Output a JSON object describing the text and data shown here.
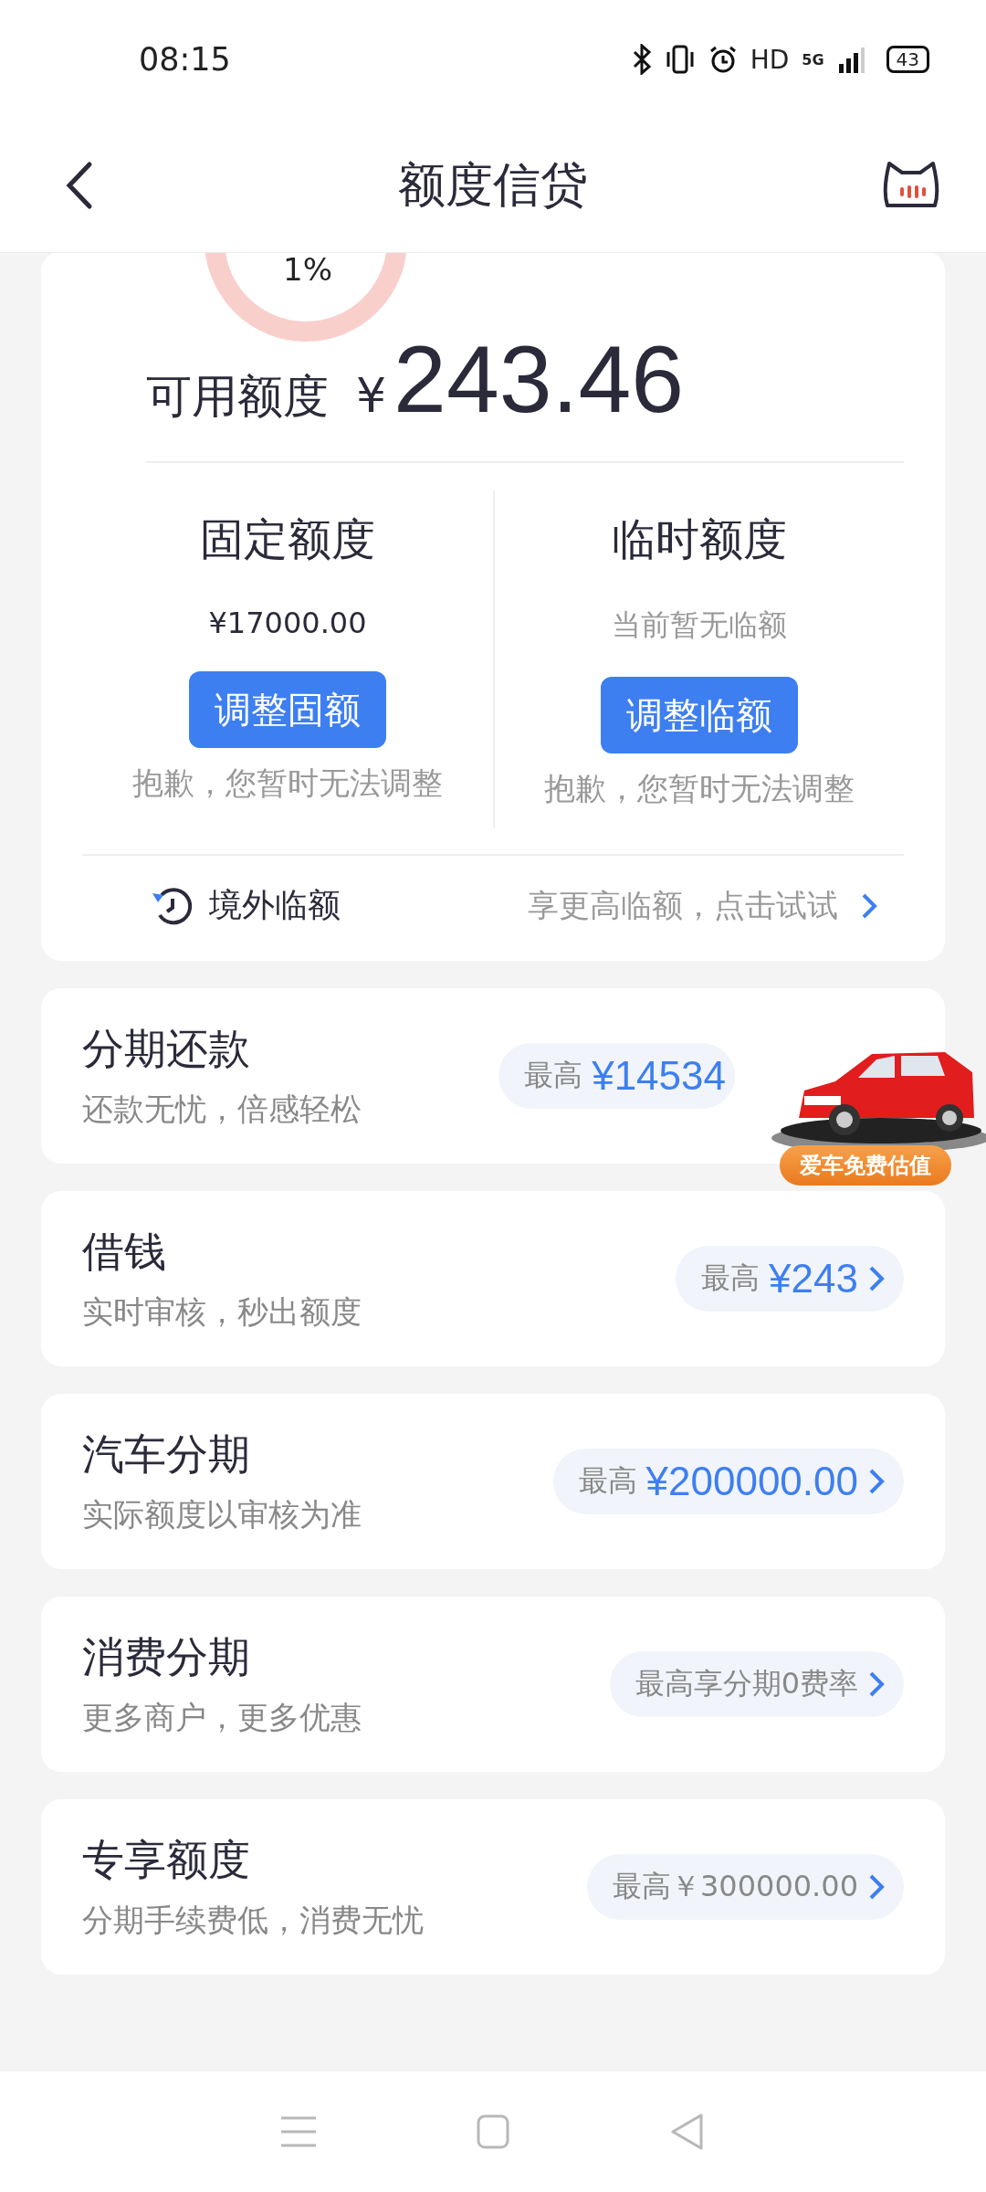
{
  "status_bar": {
    "time": "08:15",
    "hd": "HD",
    "network": "5G",
    "battery": "43"
  },
  "header": {
    "title": "额度信贷"
  },
  "summary": {
    "ring_label": "1%",
    "available_label": "可用额度",
    "currency": "¥",
    "available_amount": "243.46"
  },
  "quotas": [
    {
      "title": "固定额度",
      "value": "¥17000.00",
      "value_muted": false,
      "button": "调整固额",
      "note": "抱歉，您暂时无法调整"
    },
    {
      "title": "临时额度",
      "value": "当前暂无临额",
      "value_muted": true,
      "button": "调整临额",
      "note": "抱歉，您暂时无法调整"
    }
  ],
  "overseas": {
    "label": "境外临额",
    "action": "享更高临额，点击试试"
  },
  "products": [
    {
      "title": "分期还款",
      "subtitle": "还款无忧，倍感轻松",
      "prefix": "最高",
      "amount": "¥14534",
      "kind": "amount",
      "ad": {
        "kind": "picture",
        "badge": "爱车免费估值"
      }
    },
    {
      "title": "借钱",
      "subtitle": "实时审核，秒出额度",
      "prefix": "最高",
      "amount": "¥243",
      "kind": "amount"
    },
    {
      "title": "汽车分期",
      "subtitle": "实际额度以审核为准",
      "prefix": "最高",
      "amount": "¥200000.00",
      "kind": "amount"
    },
    {
      "title": "消费分期",
      "subtitle": "更多商户，更多优惠",
      "prefix": "最高享分期0费率",
      "kind": "plain"
    },
    {
      "title": "专享额度",
      "subtitle": "分期手续费低，消费无忧",
      "prefix": "最高￥300000.00",
      "kind": "plain"
    }
  ]
}
